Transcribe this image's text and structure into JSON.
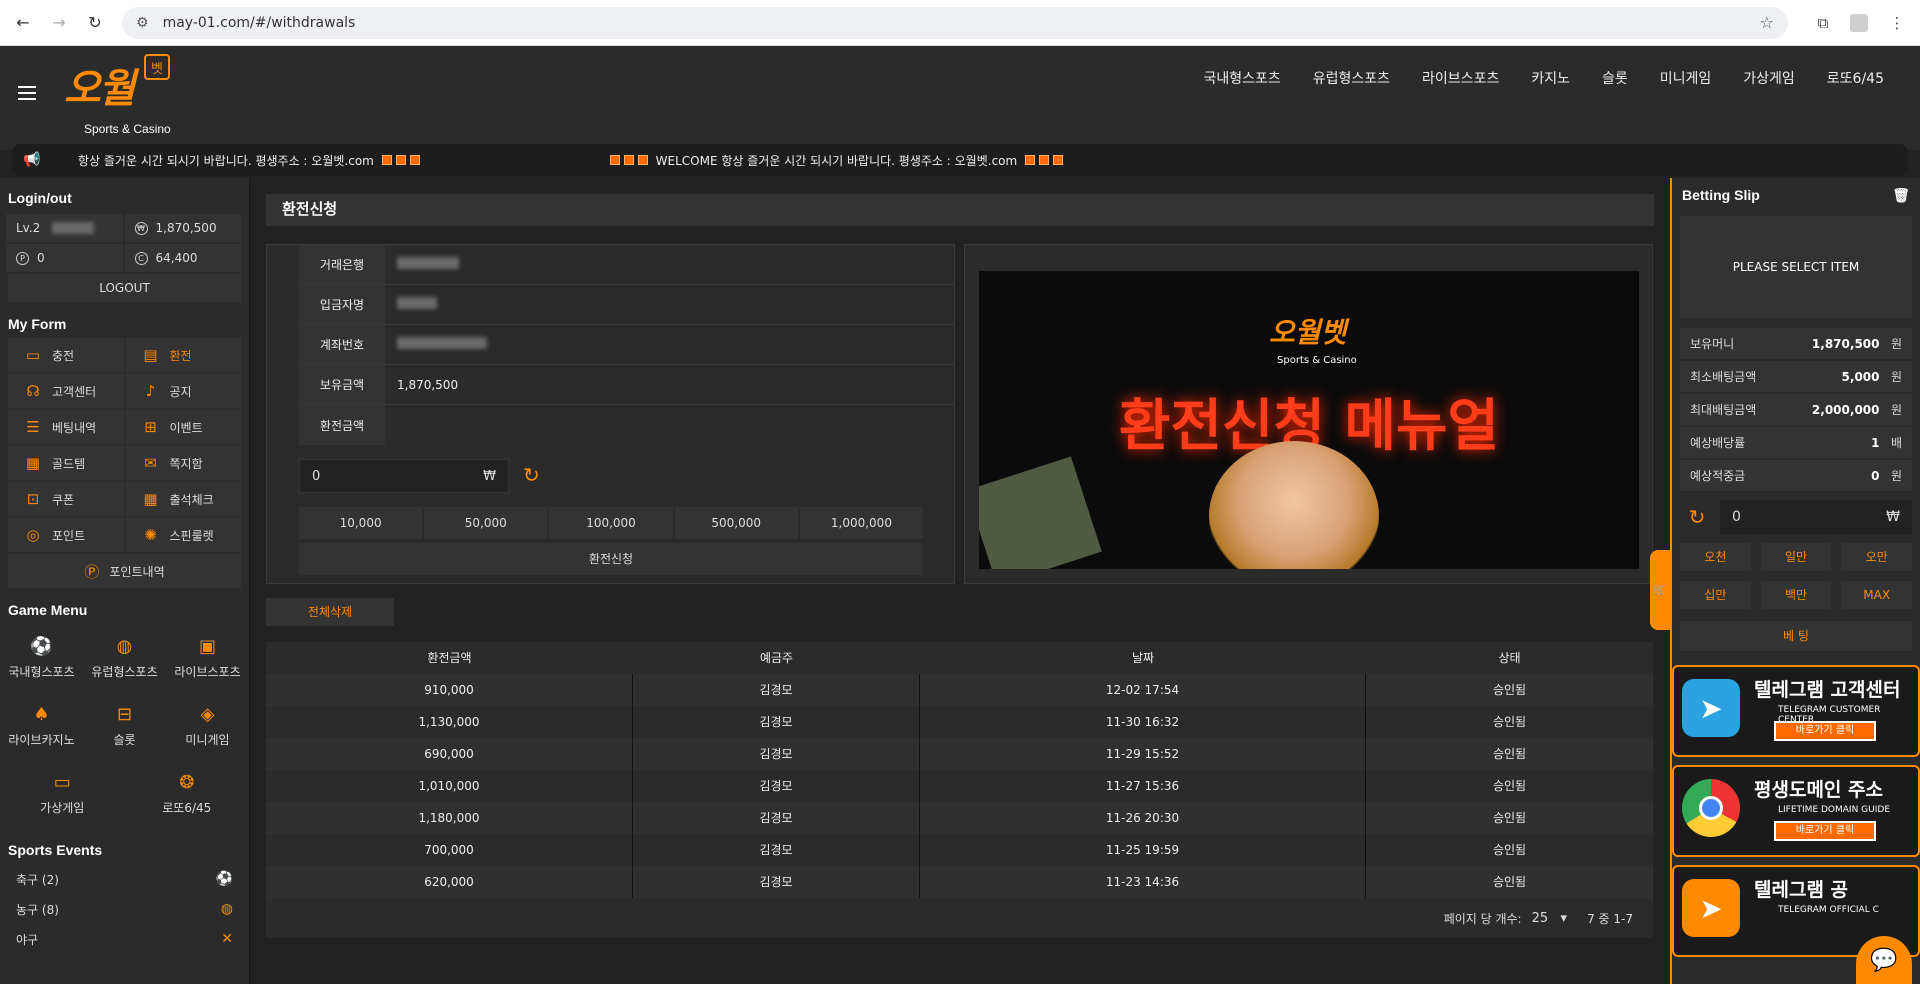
{
  "browser": {
    "url": "may-01.com/#/withdrawals"
  },
  "header": {
    "logo_mark": "오월",
    "logo_box": "벳",
    "logo_sub": "Sports & Casino",
    "nav": [
      "국내형스포츠",
      "유럽형스포츠",
      "라이브스포츠",
      "카지노",
      "슬롯",
      "미니게임",
      "가상게임",
      "로또6/45"
    ],
    "ticker1": "항상 즐거운 시간 되시기 바랍니다. 평생주소 : 오월벳.com",
    "ticker2": "WELCOME 항상 즐거운 시간 되시기 바랍니다. 평생주소 : 오월벳.com"
  },
  "left": {
    "login_title": "Login/out",
    "level": "Lv.2",
    "balance": "1,870,500",
    "points": "0",
    "coupon": "64,400",
    "logout": "LOGOUT",
    "form_title": "My Form",
    "form_items": [
      "충전",
      "환전",
      "고객센터",
      "공지",
      "베팅내역",
      "이벤트",
      "골드템",
      "쪽지함",
      "쿠폰",
      "출석체크",
      "포인트",
      "스핀룰렛"
    ],
    "point_log": "포인트내역",
    "game_title": "Game Menu",
    "games": [
      "국내형스포츠",
      "유럽형스포츠",
      "라이브스포츠",
      "라이브카지노",
      "슬롯",
      "미니게임",
      "가상게임",
      "로또6/45"
    ],
    "sports_title": "Sports Events",
    "sports": [
      "축구 (2)",
      "농구 (8)",
      "야구"
    ]
  },
  "main": {
    "title": "환전신청",
    "labels": {
      "bank": "거래은행",
      "holder": "입금자명",
      "account": "계좌번호",
      "owned": "보유금액",
      "amount": "환전금액"
    },
    "owned_value": "1,870,500",
    "amount_value": "0",
    "currency": "₩",
    "presets": [
      "10,000",
      "50,000",
      "100,000",
      "500,000",
      "1,000,000"
    ],
    "submit": "환전신청",
    "banner": {
      "logo": "오월벳",
      "sub": "Sports & Casino",
      "title": "환전신청 메뉴얼"
    },
    "delete_all": "전체삭제",
    "table": {
      "headers": [
        "환전금액",
        "예금주",
        "날짜",
        "상태"
      ],
      "rows": [
        [
          "910,000",
          "김경모",
          "12-02 17:54",
          "승인됨"
        ],
        [
          "1,130,000",
          "김경모",
          "11-30 16:32",
          "승인됨"
        ],
        [
          "690,000",
          "김경모",
          "11-29 15:52",
          "승인됨"
        ],
        [
          "1,010,000",
          "김경모",
          "11-27 15:36",
          "승인됨"
        ],
        [
          "1,180,000",
          "김경모",
          "11-26 20:30",
          "승인됨"
        ],
        [
          "700,000",
          "김경모",
          "11-25 19:59",
          "승인됨"
        ],
        [
          "620,000",
          "김경모",
          "11-23 14:36",
          "승인됨"
        ]
      ]
    },
    "pager": {
      "label": "페이지 당 개수:",
      "size": "25",
      "range": "7 중 1-7"
    }
  },
  "slip": {
    "title": "Betting Slip",
    "empty": "PLEASE SELECT ITEM",
    "rows": [
      {
        "label": "보유머니",
        "value": "1,870,500",
        "unit": "원"
      },
      {
        "label": "최소배팅금액",
        "value": "5,000",
        "unit": "원"
      },
      {
        "label": "최대배팅금액",
        "value": "2,000,000",
        "unit": "원"
      },
      {
        "label": "예상배당률",
        "value": "1",
        "unit": "배"
      },
      {
        "label": "예상적중금",
        "value": "0",
        "unit": "원"
      }
    ],
    "bet_value": "0",
    "quick": [
      "오천",
      "일만",
      "오만",
      "십만",
      "백만",
      "MAX"
    ],
    "bet_button": "베 팅",
    "promos": [
      {
        "title": "텔레그램 고객센터",
        "sub": "TELEGRAM CUSTOMER CENTER",
        "btn": "바로가기 클릭"
      },
      {
        "title": "평생도메인 주소",
        "sub": "LIFETIME DOMAIN GUIDE",
        "btn": "바로가기 클릭"
      },
      {
        "title": "텔레그램 공",
        "sub": "TELEGRAM OFFICIAL C",
        "btn": ""
      }
    ]
  }
}
